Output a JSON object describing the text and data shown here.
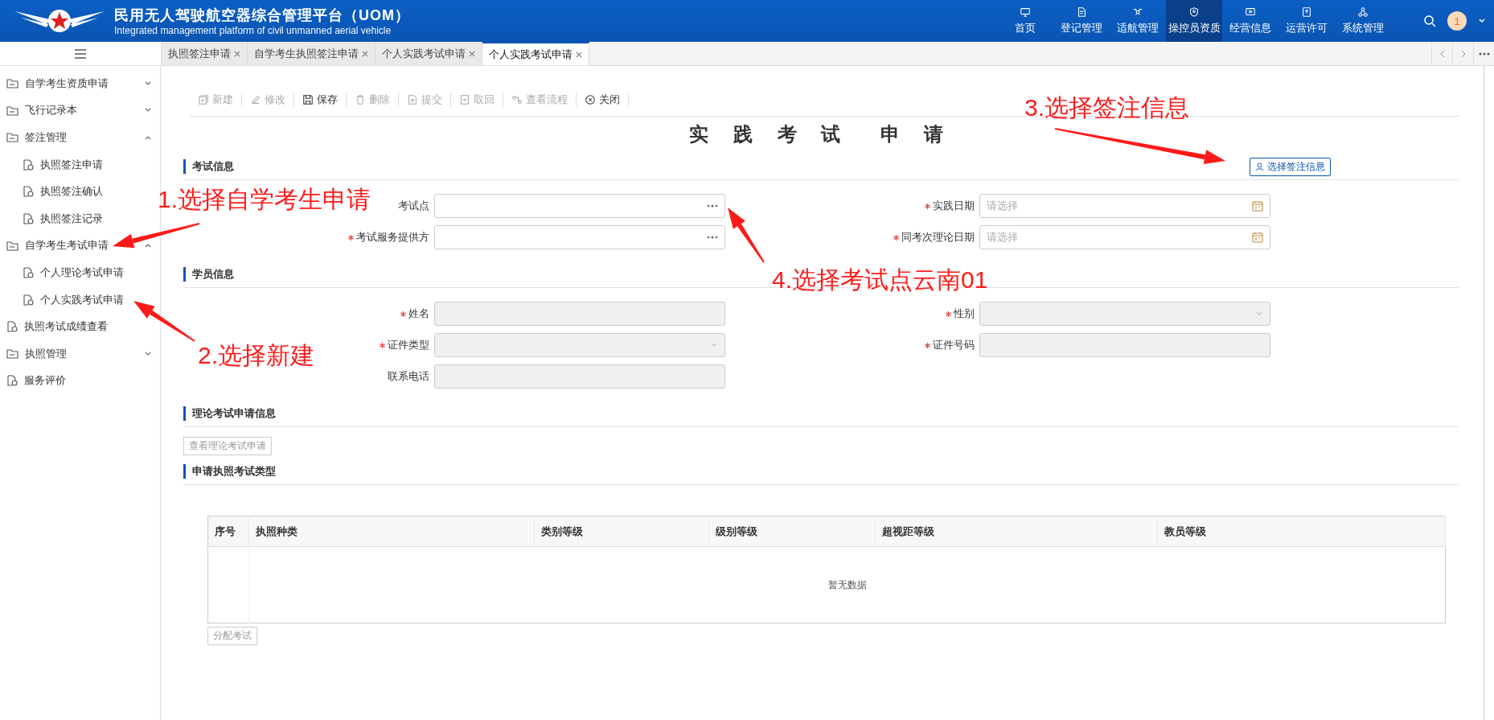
{
  "header": {
    "title": "民用无人驾驶航空器综合管理平台（UOM）",
    "subtitle": "Integrated management platform of civil unmanned aerial vehicle",
    "nav": [
      {
        "label": "首页",
        "selected": false
      },
      {
        "label": "登记管理",
        "selected": false
      },
      {
        "label": "适航管理",
        "selected": false
      },
      {
        "label": "操控员资质",
        "selected": true
      },
      {
        "label": "经营信息",
        "selected": false
      },
      {
        "label": "运营许可",
        "selected": false
      },
      {
        "label": "系统管理",
        "selected": false
      }
    ],
    "avatar": "1"
  },
  "tabs": [
    {
      "label": "执照签注申请",
      "selected": false
    },
    {
      "label": "自学考生执照签注申请",
      "selected": false
    },
    {
      "label": "个人实践考试申请",
      "selected": false
    },
    {
      "label": "个人实践考试申请",
      "selected": true
    }
  ],
  "sidebar": {
    "items": [
      {
        "label": "自学考生资质申请",
        "kind": "folder",
        "expanded": false
      },
      {
        "label": "飞行记录本",
        "kind": "folder",
        "expanded": false
      },
      {
        "label": "签注管理",
        "kind": "folder",
        "expanded": true,
        "children": [
          {
            "label": "执照签注申请"
          },
          {
            "label": "执照签注确认"
          },
          {
            "label": "执照签注记录"
          }
        ]
      },
      {
        "label": "自学考生考试申请",
        "kind": "folder",
        "expanded": true,
        "children": [
          {
            "label": "个人理论考试申请"
          },
          {
            "label": "个人实践考试申请"
          }
        ]
      },
      {
        "label": "执照考试成绩查看",
        "kind": "page"
      },
      {
        "label": "执照管理",
        "kind": "folder",
        "expanded": false
      },
      {
        "label": "服务评价",
        "kind": "page"
      }
    ]
  },
  "toolbar": [
    {
      "label": "新建",
      "disabled": true
    },
    {
      "label": "修改",
      "disabled": true
    },
    {
      "label": "保存",
      "disabled": false
    },
    {
      "label": "删除",
      "disabled": true
    },
    {
      "label": "提交",
      "disabled": true
    },
    {
      "label": "取回",
      "disabled": true
    },
    {
      "label": "查看流程",
      "disabled": true
    },
    {
      "label": "关闭",
      "disabled": false
    }
  ],
  "form_title": "实 践 考 试  申 请",
  "sections": [
    {
      "title": "考试信息",
      "action": "选择签注信息",
      "fields": [
        {
          "label": "考试点",
          "kind": "picker",
          "required": false
        },
        {
          "label": "实践日期",
          "kind": "date",
          "required": true,
          "placeholder": "请选择"
        },
        {
          "label": "考试服务提供方",
          "kind": "picker",
          "required": true
        },
        {
          "label": "同考次理论日期",
          "kind": "date",
          "required": true,
          "placeholder": "请选择"
        }
      ]
    },
    {
      "title": "学员信息",
      "fields": [
        {
          "label": "姓名",
          "kind": "text",
          "required": true
        },
        {
          "label": "性别",
          "kind": "select",
          "required": true
        },
        {
          "label": "证件类型",
          "kind": "select",
          "required": true
        },
        {
          "label": "证件号码",
          "kind": "text",
          "required": true
        },
        {
          "label": "联系电话",
          "kind": "text",
          "required": false
        }
      ]
    },
    {
      "title": "理论考试申请信息",
      "button": "查看理论考试申请"
    },
    {
      "title": "申请执照考试类型"
    }
  ],
  "table": {
    "columns": [
      "序号",
      "执照种类",
      "类别等级",
      "级别等级",
      "超视距等级",
      "教员等级"
    ],
    "empty_text": "暂无数据"
  },
  "footer_button": "分配考试",
  "annotations": [
    "1.选择自学考生申请",
    "2.选择新建",
    "3.选择签注信息",
    "4.选择考试点云南01"
  ]
}
